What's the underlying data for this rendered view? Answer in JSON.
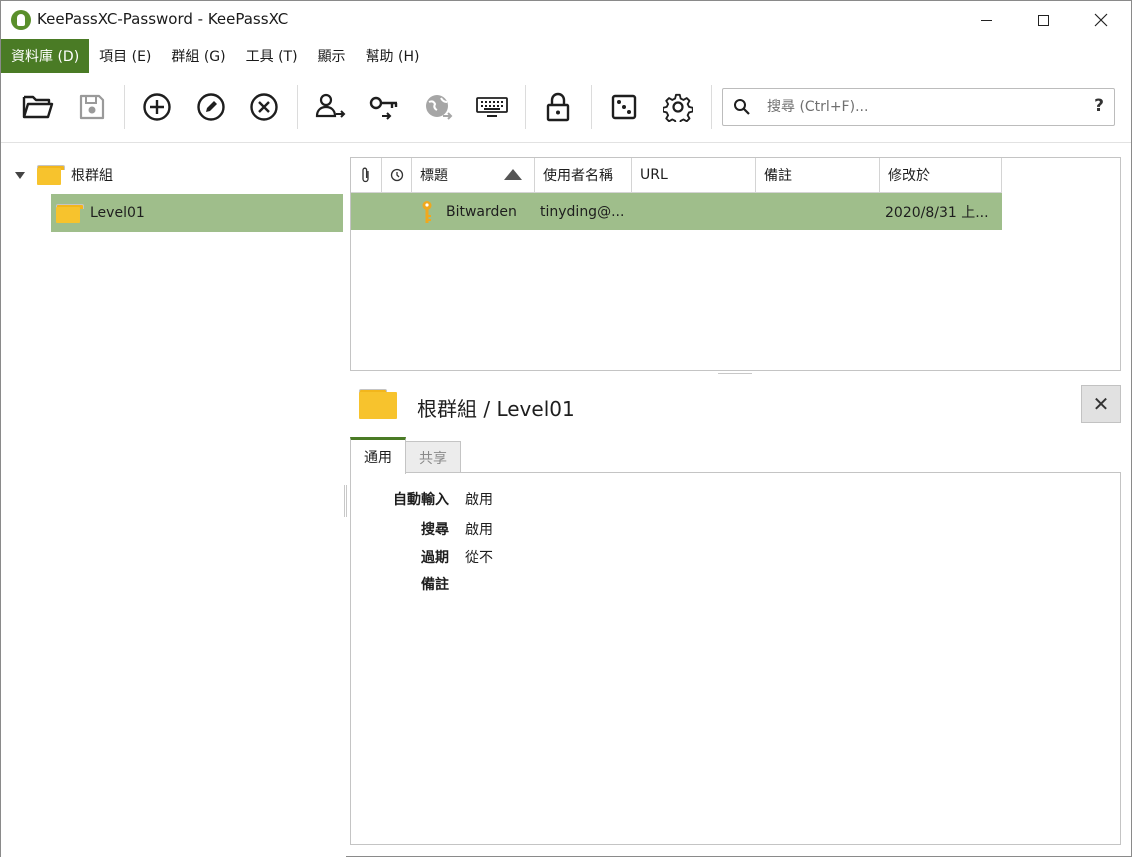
{
  "window": {
    "title": "KeePassXC-Password - KeePassXC"
  },
  "menu": {
    "items": [
      "資料庫 (D)",
      "項目 (E)",
      "群組 (G)",
      "工具 (T)",
      "顯示",
      "幫助 (H)"
    ],
    "active_index": 0
  },
  "toolbar": {
    "buttons": [
      "open-database",
      "save-database",
      "add-entry",
      "edit-entry",
      "delete-entry",
      "copy-username",
      "copy-password",
      "open-url",
      "auto-type",
      "lock-database",
      "password-generator",
      "settings"
    ]
  },
  "search": {
    "placeholder": "搜尋 (Ctrl+F)...",
    "value": "",
    "help_label": "?"
  },
  "tree": {
    "root": "根群組",
    "children": [
      "Level01"
    ],
    "selected": "Level01"
  },
  "entries": {
    "columns": [
      "",
      "",
      "標題",
      "使用者名稱",
      "URL",
      "備註",
      "修改於"
    ],
    "sorted_column": "標題",
    "sort_direction": "ascending",
    "rows": [
      {
        "title": "Bitwarden",
        "username": "tinyding@...",
        "url": "",
        "notes": "",
        "modified": "2020/8/31 上..."
      }
    ]
  },
  "details": {
    "title": "根群組 / Level01",
    "close_label": "✕",
    "tabs": [
      "通用",
      "共享"
    ],
    "active_tab": "通用",
    "fields": [
      {
        "label": "自動輸入",
        "value": "啟用"
      },
      {
        "label": "搜尋",
        "value": "啟用"
      },
      {
        "label": "過期",
        "value": "從不"
      },
      {
        "label": "備註",
        "value": ""
      }
    ]
  },
  "colors": {
    "accent": "#4a7b25",
    "selection": "#9fbe8b",
    "folder": "#f7c32d",
    "key": "#f0a81e"
  }
}
